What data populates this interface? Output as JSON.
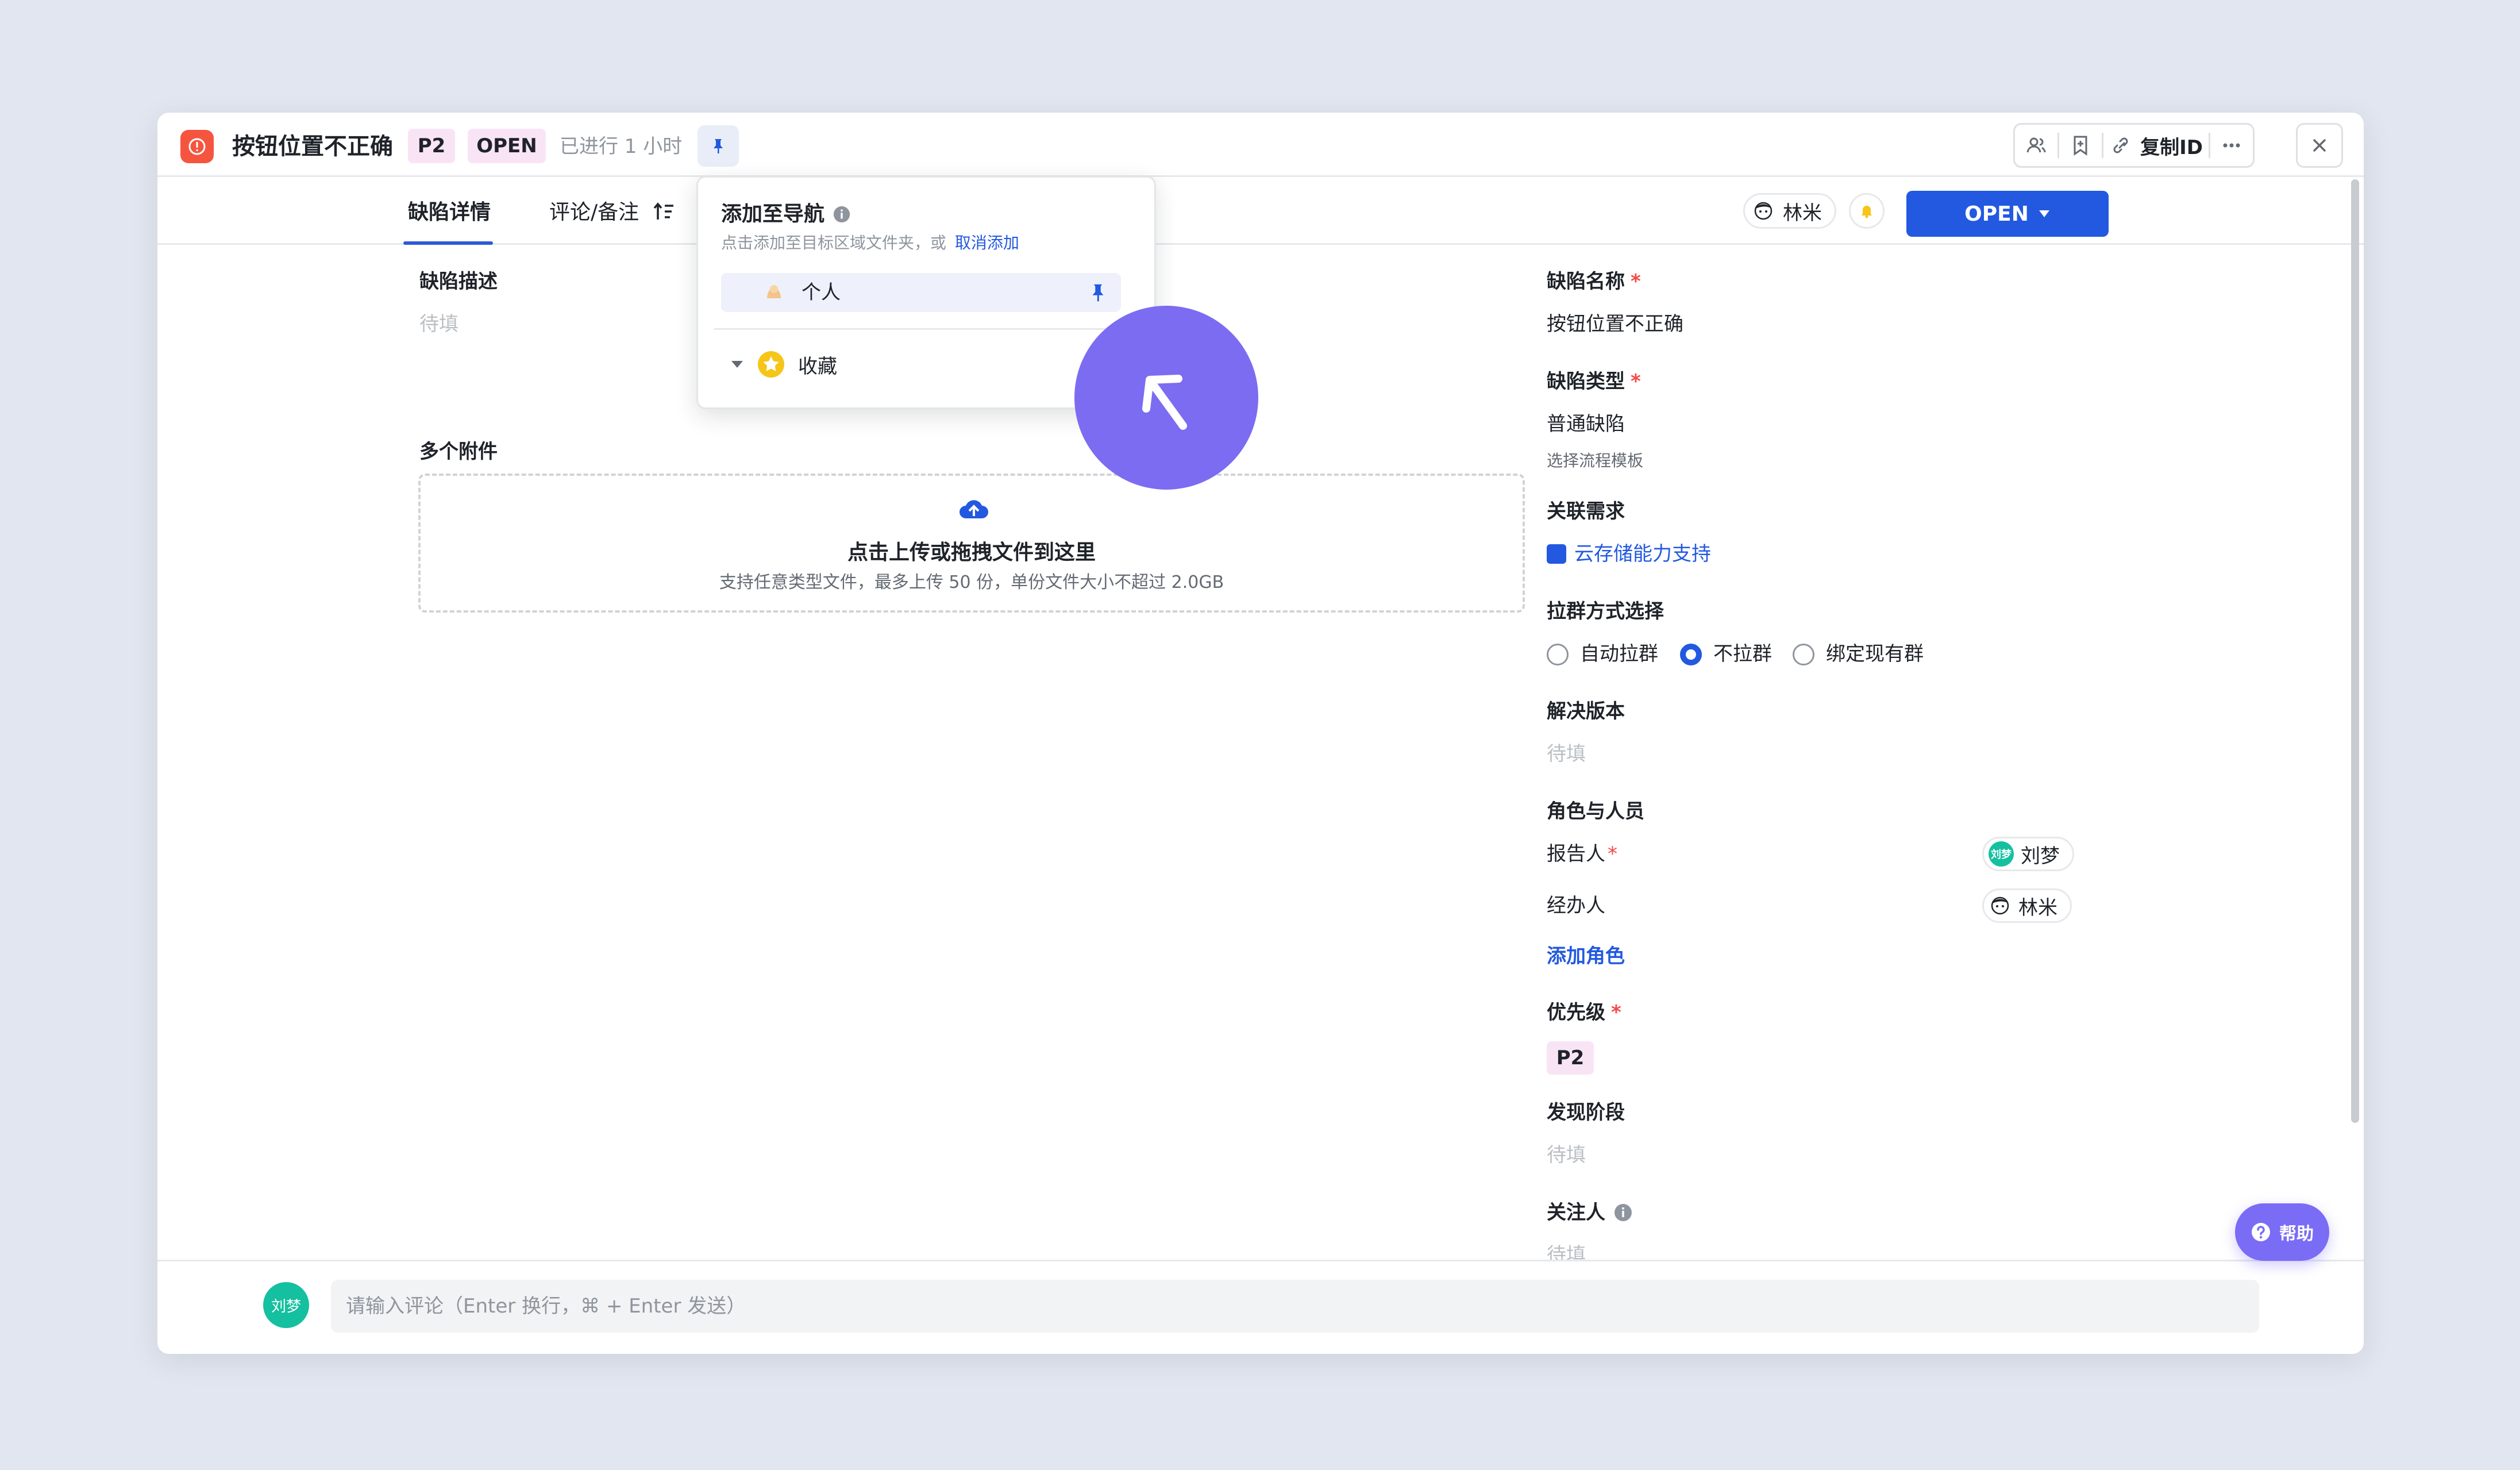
{
  "header": {
    "title": "按钮位置不正确",
    "priority_tag": "P2",
    "status_tag": "OPEN",
    "elapsed": "已进行 1 小时",
    "copy_id_label": "复制ID"
  },
  "tabs": {
    "detail": "缺陷详情",
    "comments": "评论/备注"
  },
  "top_actions": {
    "assignee_name": "林米",
    "status_button": "OPEN"
  },
  "pin_popover": {
    "title": "添加至导航",
    "subtitle": "点击添加至目标区域文件夹，或",
    "cancel_link": "取消添加",
    "personal_item": "个人",
    "favorites_item": "收藏"
  },
  "left": {
    "description_label": "缺陷描述",
    "description_placeholder": "待填",
    "attachments_label": "多个附件",
    "upload_title": "点击上传或拖拽文件到这里",
    "upload_hint": "支持任意类型文件，最多上传 50 份，单份文件大小不超过 2.0GB"
  },
  "right": {
    "name_label": "缺陷名称",
    "name_value": "按钮位置不正确",
    "type_label": "缺陷类型",
    "type_value": "普通缺陷",
    "template_hint": "选择流程模板",
    "linked_label": "关联需求",
    "linked_value": "云存储能力支持",
    "group_label": "拉群方式选择",
    "group_options": [
      "自动拉群",
      "不拉群",
      "绑定现有群"
    ],
    "group_selected": "不拉群",
    "version_label": "解决版本",
    "version_placeholder": "待填",
    "roles_label": "角色与人员",
    "reporter_label": "报告人",
    "reporter_name": "刘梦",
    "reporter_avatar_text": "刘梦",
    "handler_label": "经办人",
    "handler_name": "林米",
    "add_role": "添加角色",
    "priority_label": "优先级",
    "priority_value": "P2",
    "stage_label": "发现阶段",
    "stage_placeholder": "待填",
    "watchers_label": "关注人",
    "watchers_placeholder": "待填"
  },
  "footer": {
    "avatar_text": "刘梦",
    "comment_placeholder": "请输入评论（Enter 换行，⌘ + Enter 发送）"
  },
  "help": {
    "label": "帮助"
  },
  "colors": {
    "accent": "#2259e0",
    "danger": "#f5553f",
    "tag_bg": "#f9e4f6",
    "cursor": "#7b6cf2"
  }
}
